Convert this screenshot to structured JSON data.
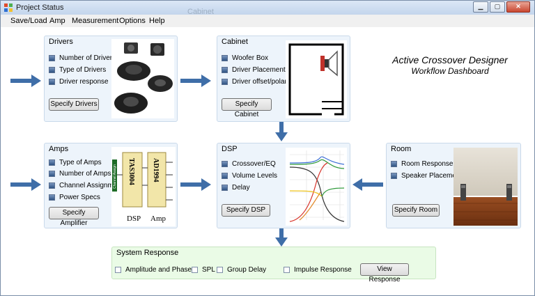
{
  "window": {
    "title": "Project Status"
  },
  "menu": [
    "Save/Load",
    "Amp",
    "Measurement",
    "Options",
    "Help"
  ],
  "header": {
    "title": "Active Crossover Designer",
    "subtitle": "Workflow Dashboard"
  },
  "background_tab_text": "Cabinet",
  "panels": {
    "drivers": {
      "title": "Drivers",
      "items": [
        "Number of Drivers",
        "Type of Drivers",
        "Driver response"
      ],
      "button": "Specify Drivers"
    },
    "cabinet": {
      "title": "Cabinet",
      "items": [
        "Woofer Box",
        "Driver Placement",
        "Driver offset/polarity"
      ],
      "button": "Specify Cabinet"
    },
    "amps": {
      "title": "Amps",
      "items": [
        "Type of Amps",
        "Number of Amps",
        "Channel Assignments",
        "Power Specs"
      ],
      "button": "Specify Amplifier",
      "image_labels": {
        "chip1": "TAS3004",
        "chip2": "AD1994",
        "side": "Channel Assign",
        "dsp": "DSP",
        "amp": "Amp"
      }
    },
    "dsp": {
      "title": "DSP",
      "items": [
        "Crossover/EQ",
        "Volume Levels",
        "Delay"
      ],
      "button": "Specify DSP"
    },
    "room": {
      "title": "Room",
      "items": [
        "Room Response",
        "Speaker Placement"
      ],
      "button": "Specify Room"
    }
  },
  "system_response": {
    "title": "System Response",
    "options": [
      "Amplitude and Phase",
      "SPL",
      "Group Delay",
      "Impulse Response"
    ],
    "button": "View Response"
  },
  "colors": {
    "panel_bg": "#edf4fb",
    "system_bg": "#eafbe6",
    "arrow": "#3f6ea8",
    "checkbox": "#3a5f90"
  }
}
